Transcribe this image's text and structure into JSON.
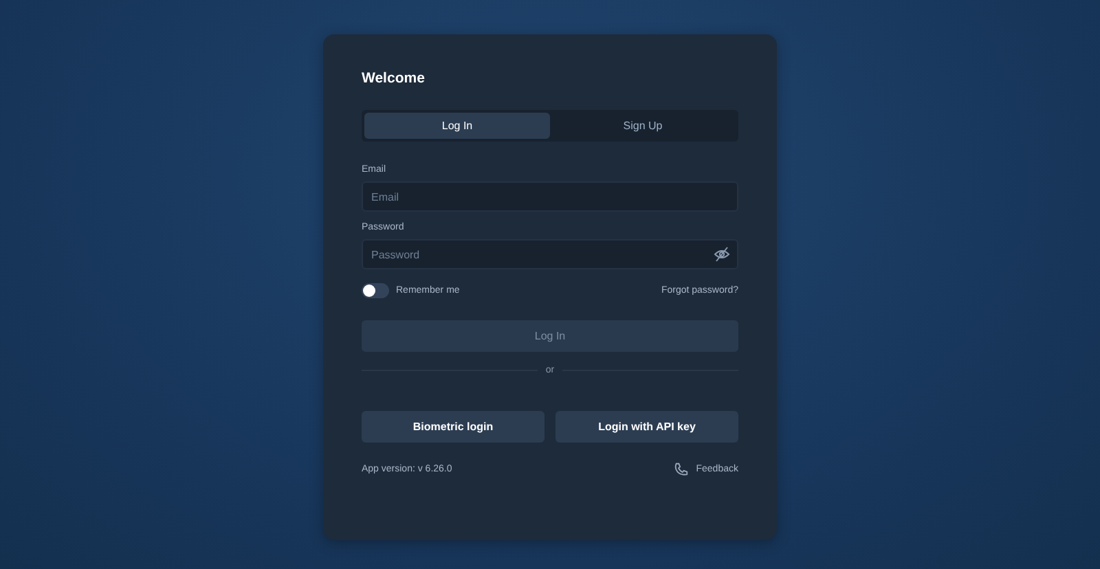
{
  "title": "Welcome",
  "tabs": [
    {
      "label": "Log In",
      "selected": true
    },
    {
      "label": "Sign Up",
      "selected": false
    }
  ],
  "fields": [
    {
      "label": "Email",
      "placeholder": "Email",
      "kind": "text"
    },
    {
      "label": "Password",
      "placeholder": "Password",
      "kind": "password"
    }
  ],
  "remember": {
    "label": "Remember me",
    "on": false
  },
  "forgot_link": "Forgot password?",
  "submit": {
    "label": "Log In",
    "disabled": true
  },
  "divider": "or",
  "alt_buttons": [
    "Biometric login",
    "Login with API key"
  ],
  "version": "App version: v 6.26.0",
  "feedback": "Feedback"
}
